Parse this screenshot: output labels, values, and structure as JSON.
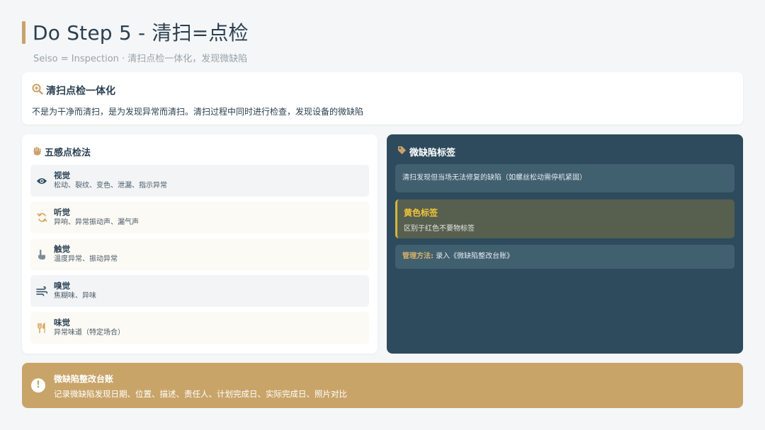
{
  "header": {
    "title": "Do Step 5 - 清扫=点检",
    "subtitle": "Seiso = Inspection · 清扫点检一体化，发现微缺陷"
  },
  "intro": {
    "icon": "search-plus-icon",
    "title": "清扫点检一体化",
    "description": "不是为干净而清扫，是为发现异常而清扫。清扫过程中同时进行检查，发现设备的微缺陷"
  },
  "senses": {
    "icon": "hand-icon",
    "title": "五感点检法",
    "items": [
      {
        "icon": "eye-icon",
        "name": "视觉",
        "desc": "松动、裂纹、变色、泄漏、指示异常"
      },
      {
        "icon": "sync-icon",
        "name": "听觉",
        "desc": "异响、异常振动声、漏气声"
      },
      {
        "icon": "hand-pointer-icon",
        "name": "触觉",
        "desc": "温度异常、振动异常"
      },
      {
        "icon": "wind-icon",
        "name": "嗅觉",
        "desc": "焦糊味、异味"
      },
      {
        "icon": "utensils-icon",
        "name": "味觉",
        "desc": "异常味道（特定场合）"
      }
    ]
  },
  "defect_tag": {
    "icon": "tag-icon",
    "title": "微缺陷标签",
    "description": "清扫发现但当场无法修复的缺陷（如螺丝松动需停机紧固）",
    "yellow": {
      "title": "黄色标签",
      "desc": "区别于红色不要物标签"
    },
    "method_label": "管理方法:",
    "method_value": "录入《微缺陷整改台账》"
  },
  "banner": {
    "icon": "exclamation-icon",
    "icon_glyph": "!",
    "title": "微缺陷整改台账",
    "description": "记录微缺陷发现日期、位置、描述、责任人、计划完成日、实际完成日、照片对比"
  },
  "colors": {
    "accent": "#c9a26a",
    "dark_panel": "#2d4b5c",
    "yellow_tag": "#f0c53a"
  }
}
